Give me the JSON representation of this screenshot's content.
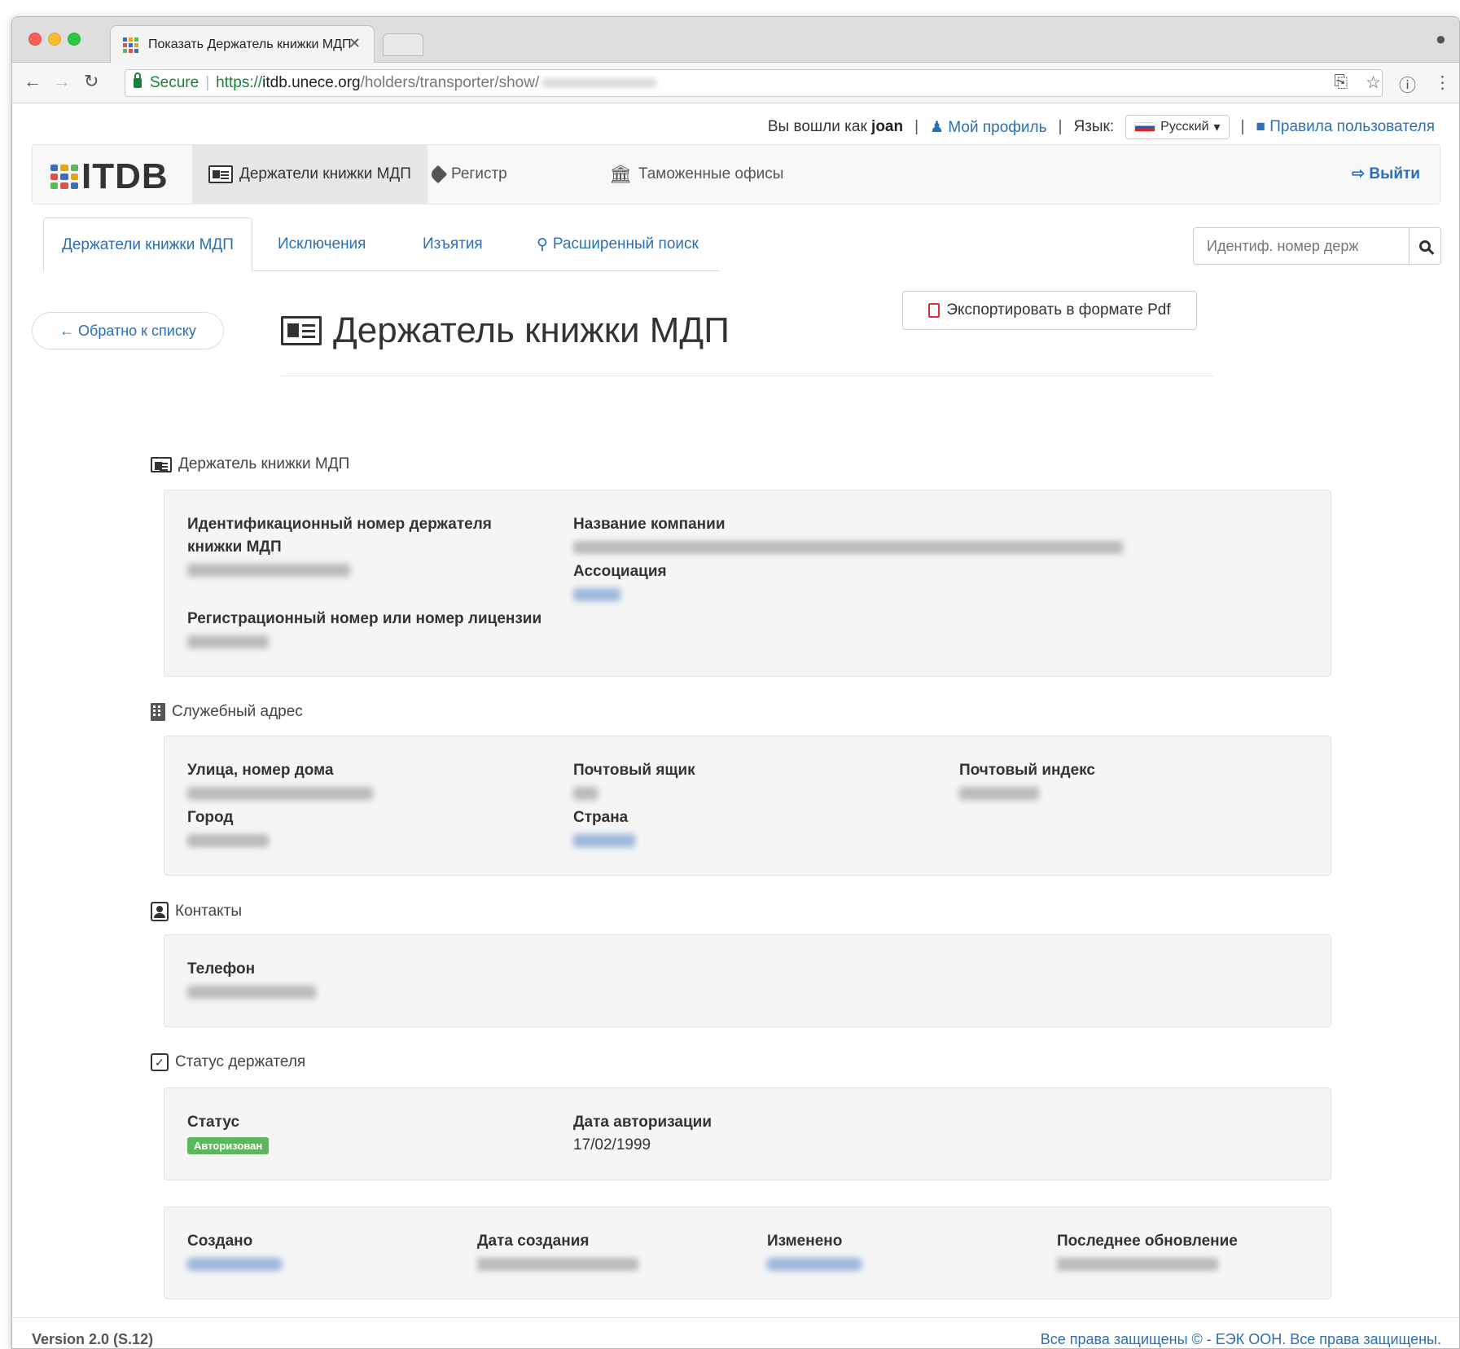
{
  "browser": {
    "tab_title": "Показать Держатель книжки МДП",
    "secure_label": "Secure",
    "url_scheme": "https://",
    "url_host": "itdb.unece.org",
    "url_path": "/holders/transporter/show/"
  },
  "topbar": {
    "logged_in_as": "Вы вошли как",
    "username": "joan",
    "profile": "Мой профиль",
    "language_label": "Язык:",
    "language_value": "Русский",
    "user_rules": "Правила пользователя"
  },
  "navbar": {
    "brand": "ITDB",
    "items": [
      {
        "label": "Держатели книжки МДП",
        "icon": "id-card-icon",
        "active": true
      },
      {
        "label": "Регистр",
        "icon": "tag-icon"
      },
      {
        "label": "Таможенные офисы",
        "icon": "bank-icon"
      }
    ],
    "logout": "Выйти"
  },
  "subtabs": [
    {
      "label": "Держатели книжки МДП",
      "active": true
    },
    {
      "label": "Исключения"
    },
    {
      "label": "Изъятия"
    },
    {
      "label": "Расширенный поиск",
      "icon": "search-icon"
    }
  ],
  "search": {
    "placeholder": "Идентиф. номер держ"
  },
  "back_button": "← Обратно к списку",
  "page_title": "Держатель книжки МДП",
  "export_button": "Экспортировать в формате Pdf",
  "sections": {
    "holder": {
      "title": "Держатель книжки МДП",
      "id_label": "Идентификационный номер держателя книжки МДП",
      "reg_label": "Регистрационный номер или номер лицензии",
      "company_label": "Название компании",
      "association_label": "Ассоциация"
    },
    "address": {
      "title": "Служебный адрес",
      "street_label": "Улица, номер дома",
      "pobox_label": "Почтовый ящик",
      "postal_label": "Почтовый индекс",
      "city_label": "Город",
      "country_label": "Страна"
    },
    "contacts": {
      "title": "Контакты",
      "phone_label": "Телефон"
    },
    "status": {
      "title": "Статус держателя",
      "status_label": "Статус",
      "status_value": "Авторизован",
      "auth_date_label": "Дата авторизации",
      "auth_date_value": "17/02/1999"
    },
    "meta": {
      "created_label": "Создано",
      "created_date_label": "Дата создания",
      "modified_label": "Изменено",
      "last_update_label": "Последнее обновление"
    }
  },
  "footer": {
    "version": "Version 2.0 (S.12)",
    "copyright": "Все права защищены © - ЕЭК ООН. Все права защищены."
  },
  "colors": {
    "link": "#2a6fb6",
    "badge": "#5cb85c"
  }
}
